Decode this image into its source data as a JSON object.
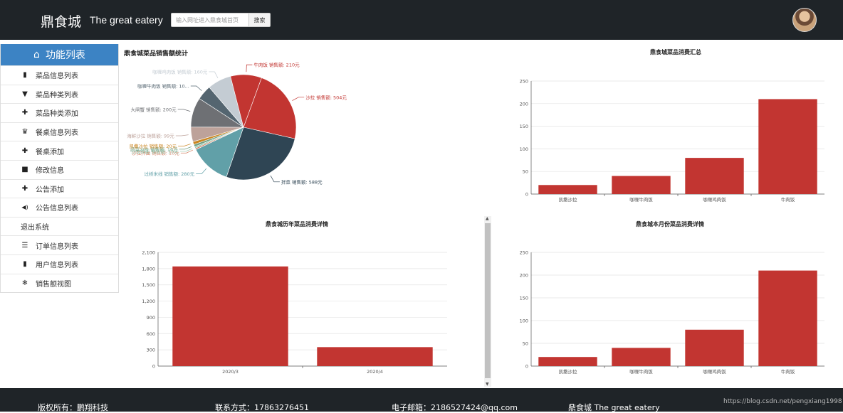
{
  "header": {
    "brand": "鼎食城",
    "brand_en": "The great eatery",
    "search_placeholder": "输入网址进入鼎食城首页",
    "search_button": "搜索"
  },
  "sidebar": {
    "title": "功能列表",
    "items": [
      {
        "label": "菜品信息列表",
        "icon": "book-icon"
      },
      {
        "label": "菜品种类列表",
        "icon": "filter-icon"
      },
      {
        "label": "菜品种类添加",
        "icon": "plus-icon"
      },
      {
        "label": "餐桌信息列表",
        "icon": "crown-icon"
      },
      {
        "label": "餐桌添加",
        "icon": "plus-icon"
      },
      {
        "label": "修改信息",
        "icon": "briefcase-icon"
      },
      {
        "label": "公告添加",
        "icon": "plus-icon"
      },
      {
        "label": "公告信息列表",
        "icon": "volume-icon"
      },
      {
        "label": "退出系统",
        "icon": ""
      },
      {
        "label": "订单信息列表",
        "icon": "list-icon"
      },
      {
        "label": "用户信息列表",
        "icon": "book-icon"
      },
      {
        "label": "销售额视图",
        "icon": "fire-icon"
      }
    ]
  },
  "colors": {
    "bar": "#c23531",
    "accent": "#3c83c4",
    "dark": "#1f2428"
  },
  "chart_data": [
    {
      "type": "pie",
      "title": "鼎食城菜品销售额统计",
      "slices": [
        {
          "label": "沙拉 销售额: 504元",
          "value": 504,
          "color": "#c23531"
        },
        {
          "label": "拌菜 销售额: 588元",
          "value": 588,
          "color": "#2f4554"
        },
        {
          "label": "过桥米线 销售额: 280元",
          "value": 280,
          "color": "#61a0a8"
        },
        {
          "label": "沙拉拌面 销售额: 10元",
          "value": 10,
          "color": "#d48265"
        },
        {
          "label": "沙拉拌面 销售额: 10元",
          "value": 10,
          "color": "#91c7ae"
        },
        {
          "label": "蔬菜沙拉 销售额: 16元",
          "value": 16,
          "color": "#749f83"
        },
        {
          "label": "凯撒沙拉 销售额: 20元",
          "value": 20,
          "color": "#ca8622"
        },
        {
          "label": "海鲜沙拉 销售额: 99元",
          "value": 99,
          "color": "#bda29a"
        },
        {
          "label": "大闸蟹 销售额: 200元",
          "value": 200,
          "color": "#6e7074"
        },
        {
          "label": "咖喱牛肉饭 销售额: 10...",
          "value": 100,
          "color": "#546570"
        },
        {
          "label": "咖喱鸡肉饭 销售额: 160元",
          "value": 160,
          "color": "#c4ccd3"
        },
        {
          "label": "牛肉饭 销售额: 210元",
          "value": 210,
          "color": "#c23531"
        }
      ]
    },
    {
      "type": "bar",
      "title": "鼎食城菜品消费汇总",
      "categories": [
        "凯撒沙拉",
        "咖喱牛肉饭",
        "咖喱鸡肉饭",
        "牛肉饭"
      ],
      "values": [
        20,
        40,
        80,
        210
      ],
      "ylim": [
        0,
        250
      ],
      "yticks": [
        "0",
        "50",
        "100",
        "150",
        "200",
        "250"
      ]
    },
    {
      "type": "bar",
      "title": "鼎食城历年菜品消费详情",
      "categories": [
        "2020/3",
        "2020/4"
      ],
      "values": [
        1840,
        350
      ],
      "ylim": [
        0,
        2100
      ],
      "yticks": [
        "0",
        "300",
        "600",
        "900",
        "1,200",
        "1,500",
        "1,800",
        "2,100"
      ]
    },
    {
      "type": "bar",
      "title": "鼎食城本月份菜品消费详情",
      "categories": [
        "凯撒沙拉",
        "咖喱牛肉饭",
        "咖喱鸡肉饭",
        "牛肉饭"
      ],
      "values": [
        20,
        40,
        80,
        210
      ],
      "ylim": [
        0,
        250
      ],
      "yticks": [
        "0",
        "50",
        "100",
        "150",
        "200",
        "250"
      ]
    }
  ],
  "footer": {
    "copyright": "版权所有：鹏翔科技",
    "contact": "联系方式：17863276451",
    "email": "电子邮箱：2186527424@qq.com",
    "brand": "鼎食城 The great eatery",
    "watermark": "https://blog.csdn.net/pengxiang1998"
  }
}
